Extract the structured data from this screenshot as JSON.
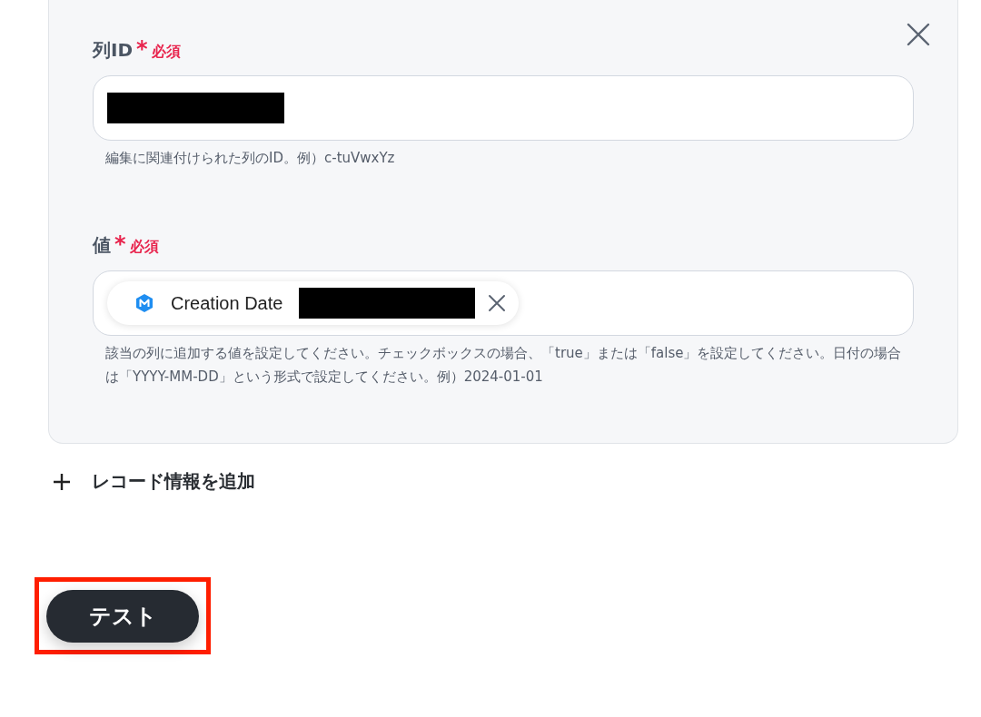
{
  "fields": [
    {
      "kind": "text",
      "label": "列ID",
      "required_mark": "*",
      "required_label": "必須",
      "value_redacted": true,
      "help": "編集に関連付けられた列のID。例）c-tuVwxYz"
    },
    {
      "kind": "token",
      "label": "値",
      "required_mark": "*",
      "required_label": "必須",
      "token": {
        "label": "Creation Date",
        "value_redacted": true
      },
      "help": "該当の列に追加する値を設定してください。チェックボックスの場合、「true」または「false」を設定してください。日付の場合は「YYYY-MM-DD」という形式で設定してください。例）2024-01-01"
    }
  ],
  "add_button": {
    "label": "レコード情報を追加"
  },
  "test_button": {
    "label": "テスト",
    "highlighted": true
  }
}
